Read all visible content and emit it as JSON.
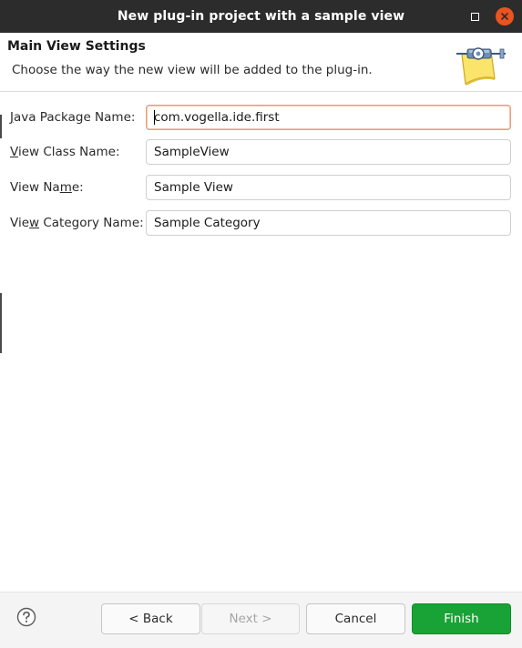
{
  "window": {
    "title": "New plug-in project with a sample view"
  },
  "header": {
    "title": "Main View Settings",
    "description": "Choose the way the new view will be added to the plug-in.",
    "icon": "plug-in-wizard-icon"
  },
  "form": {
    "fields": [
      {
        "label": "Java Package Name:",
        "mnemonic_index": 0,
        "value": "com.vogella.ide.first",
        "focused": true
      },
      {
        "label": "View Class Name:",
        "mnemonic_index": 0,
        "value": "SampleView",
        "focused": false
      },
      {
        "label": "View Name:",
        "mnemonic_index": 7,
        "value": "Sample View",
        "focused": false
      },
      {
        "label": "View Category Name:",
        "mnemonic_index": 3,
        "value": "Sample Category",
        "focused": false
      }
    ]
  },
  "footer": {
    "help_icon": "help-icon",
    "back_label": "< Back",
    "next_label": "Next >",
    "cancel_label": "Cancel",
    "finish_label": "Finish"
  },
  "colors": {
    "titlebar": "#2c2c2c",
    "close_button": "#e95420",
    "finish_button": "#19a336",
    "focus_border": "#e9a07a"
  }
}
